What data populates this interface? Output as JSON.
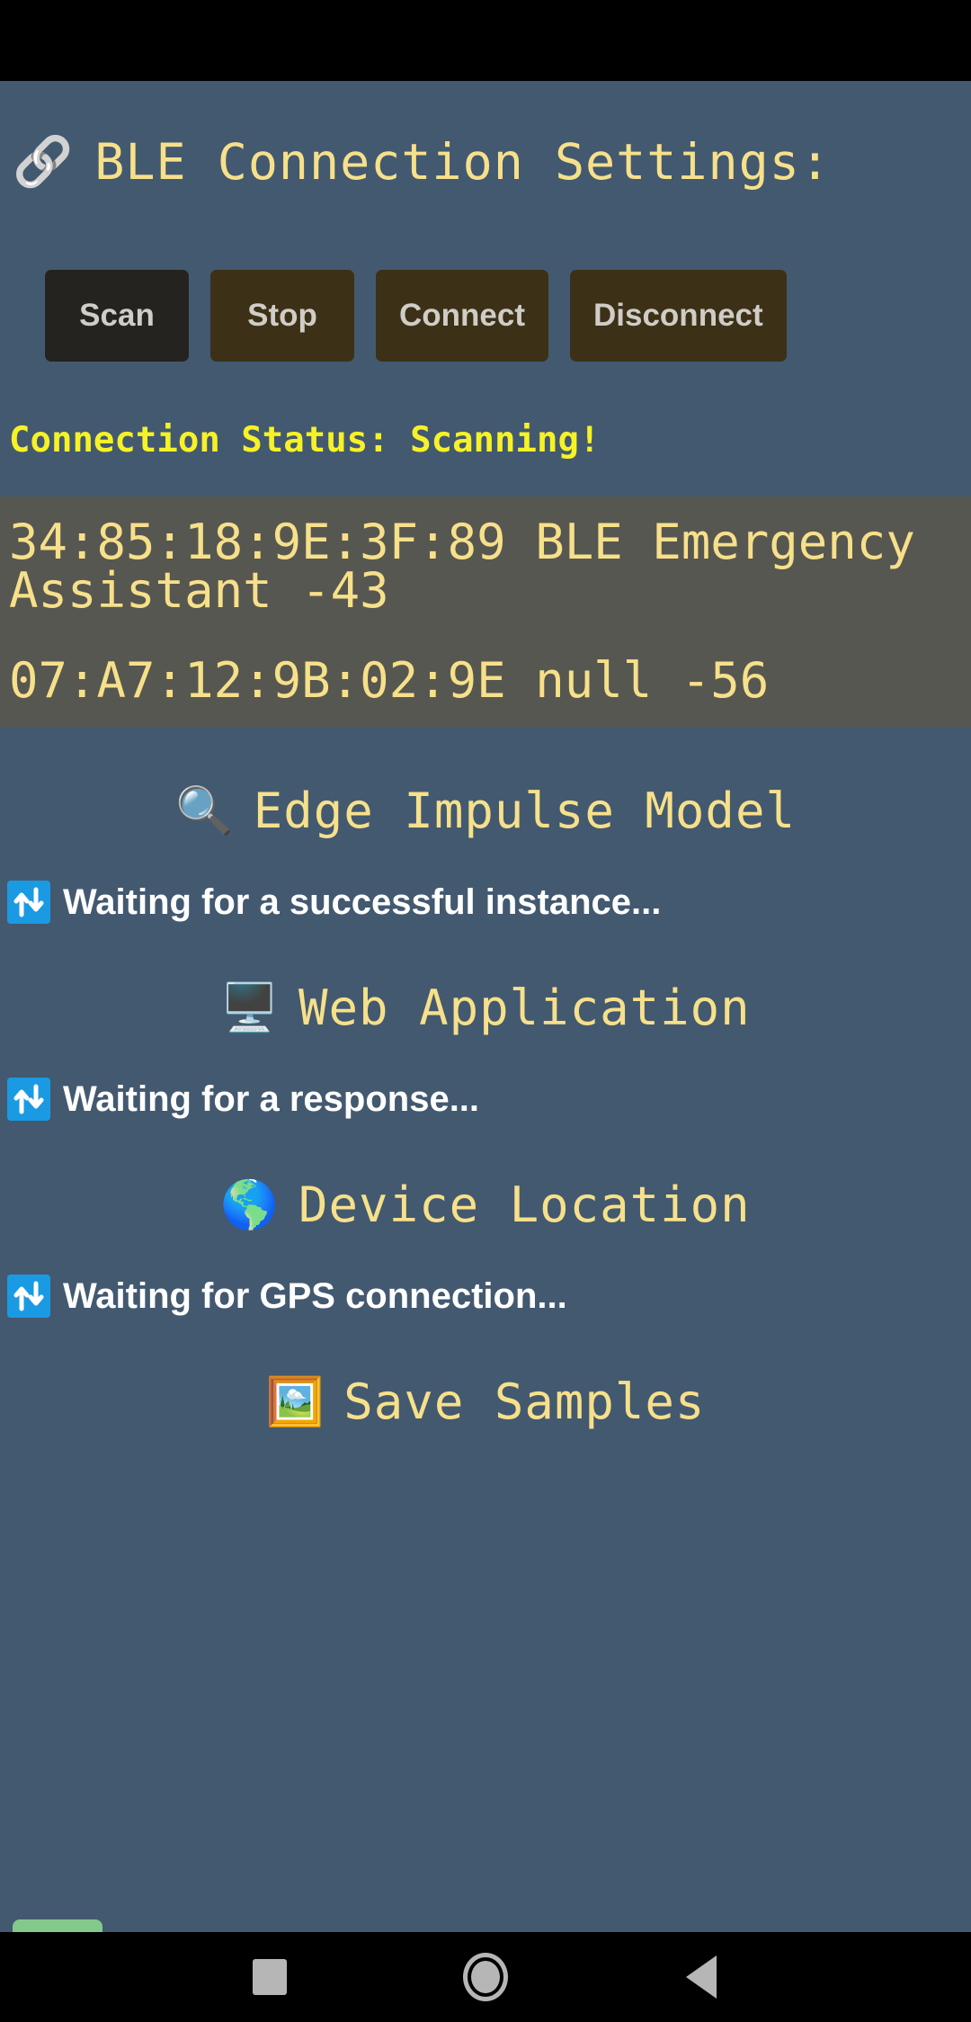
{
  "header": {
    "icon": "link-chain-icon",
    "icon_glyph": "🔗",
    "title": "BLE Connection Settings:"
  },
  "buttons": [
    {
      "label": "Scan",
      "style": "dark"
    },
    {
      "label": "Stop",
      "style": "brown"
    },
    {
      "label": "Connect",
      "style": "brown"
    },
    {
      "label": "Disconnect",
      "style": "brown"
    }
  ],
  "connection": {
    "status_text": "Connection Status: Scanning!",
    "status_color": "#f6f226"
  },
  "devices": [
    {
      "line": "34:85:18:9E:3F:89 BLE Emergency Assistant -43"
    },
    {
      "line": "07:A7:12:9B:02:9E null -56"
    }
  ],
  "sections": [
    {
      "icon": "magnifying-glass-icon",
      "icon_glyph": "🔍",
      "title": "Edge Impulse Model",
      "status_icon": "up-down-arrows-icon",
      "status_text": "Waiting for a successful instance..."
    },
    {
      "icon": "desktop-computer-icon",
      "icon_glyph": "🖥️",
      "title": "Web Application",
      "status_icon": "up-down-arrows-icon",
      "status_text": "Waiting for a response..."
    },
    {
      "icon": "globe-americas-icon",
      "icon_glyph": "🌎",
      "title": "Device Location",
      "status_icon": "up-down-arrows-icon",
      "status_text": "Waiting for GPS connection..."
    },
    {
      "icon": "framed-picture-icon",
      "icon_glyph": "🖼️",
      "title": "Save Samples",
      "status_icon": "",
      "status_text": ""
    }
  ],
  "cutoff_row": {
    "badge_color": "#82c98b",
    "text": ""
  },
  "navbar": {
    "recents_label": "",
    "home_label": "",
    "back_label": ""
  },
  "colors": {
    "app_background": "#435970",
    "device_panel": "#575751",
    "accent_yellow": "#f7e08a",
    "status_yellow": "#f6f226",
    "button_dark": "#252320",
    "button_brown": "#3c3017",
    "status_icon_blue": "#1b9ae4"
  }
}
